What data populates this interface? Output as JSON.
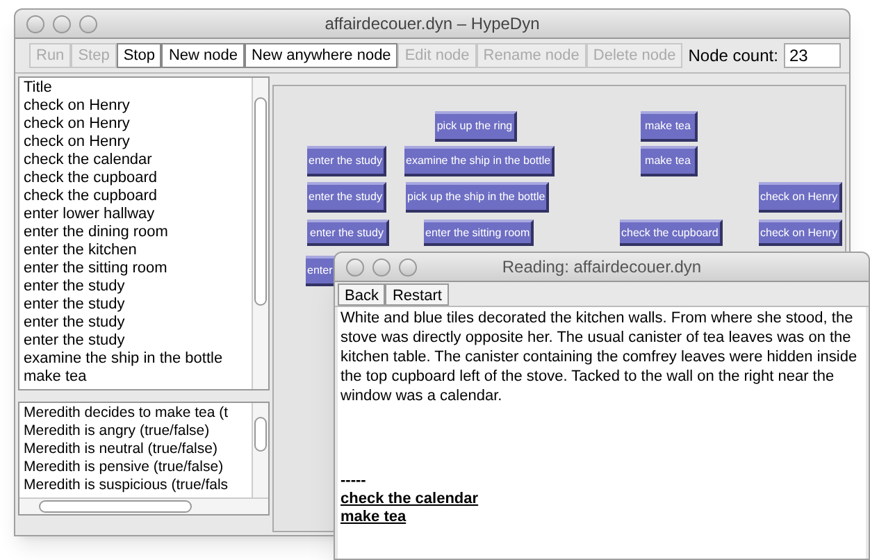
{
  "window": {
    "title": "affairdecouer.dyn – HypeDyn"
  },
  "toolbar": {
    "buttons": [
      {
        "label": "Run",
        "disabled": true
      },
      {
        "label": "Step",
        "disabled": true
      },
      {
        "label": "Stop",
        "disabled": false
      },
      {
        "label": "New node",
        "disabled": false
      },
      {
        "label": "New anywhere node",
        "disabled": false
      },
      {
        "label": "Edit node",
        "disabled": true
      },
      {
        "label": "Rename node",
        "disabled": true
      },
      {
        "label": "Delete node",
        "disabled": true
      }
    ],
    "node_count_label": "Node count:",
    "node_count": "23"
  },
  "node_list": [
    "Title",
    "check on Henry",
    "check on Henry",
    "check on Henry",
    "check the calendar",
    "check the cupboard",
    "check the cupboard",
    "enter lower hallway",
    "enter the dining room",
    "enter the kitchen",
    "enter the sitting room",
    "enter the study",
    "enter the study",
    "enter the study",
    "enter the study",
    "examine the ship in the bottle",
    "make tea"
  ],
  "fact_list": [
    "Meredith decides to make tea (t",
    "Meredith is angry (true/false)",
    "Meredith is neutral (true/false)",
    "Meredith is pensive (true/false)",
    "Meredith is suspicious (true/fals"
  ],
  "canvas_nodes": [
    {
      "label": "pick up the ring"
    },
    {
      "label": "make tea"
    },
    {
      "label": "enter the study"
    },
    {
      "label": "examine the ship in the bottle"
    },
    {
      "label": "make tea"
    },
    {
      "label": "enter the study"
    },
    {
      "label": "pick up the ship in the bottle"
    },
    {
      "label": "check on Henry"
    },
    {
      "label": "enter the study"
    },
    {
      "label": "enter the sitting room"
    },
    {
      "label": "check the cupboard"
    },
    {
      "label": "check on Henry"
    },
    {
      "label": "enter"
    }
  ],
  "reading_window": {
    "title": "Reading: affairdecouer.dyn",
    "buttons": [
      "Back",
      "Restart"
    ],
    "text": "White and blue tiles decorated the kitchen walls. From where she stood, the stove was directly opposite her. The usual canister of tea leaves was on the kitchen table. The canister containing the comfrey leaves were hidden inside the top cupboard left of the stove. Tacked to the wall on the right near the window was a calendar.",
    "separator": "-----",
    "links": [
      "check the calendar",
      "make tea"
    ]
  }
}
